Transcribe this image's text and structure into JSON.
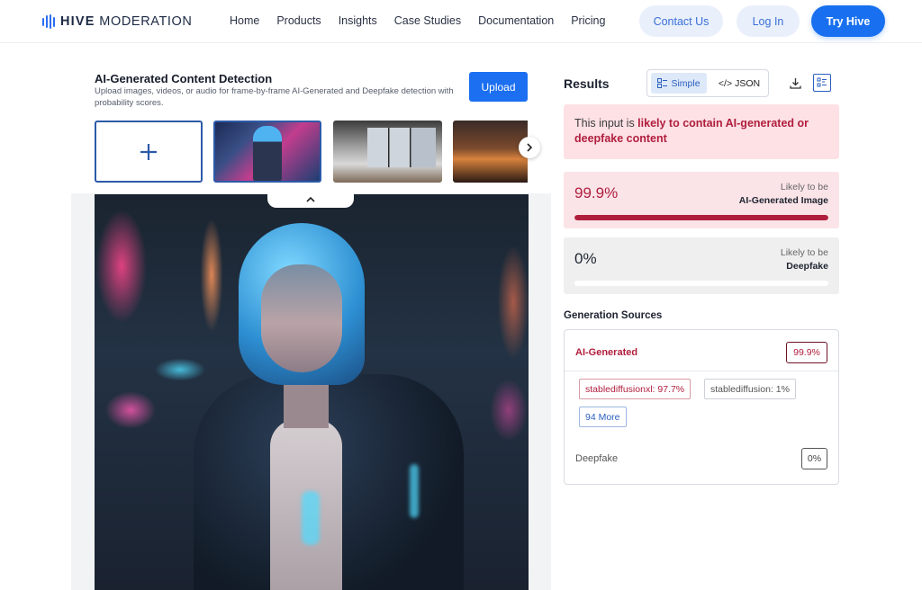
{
  "nav": {
    "brand_bold": "HIVE",
    "brand_rest": "MODERATION",
    "links": [
      "Home",
      "Products",
      "Insights",
      "Case Studies",
      "Documentation",
      "Pricing"
    ],
    "contact": "Contact Us",
    "login": "Log In",
    "try": "Try Hive"
  },
  "detection": {
    "title": "AI-Generated Content Detection",
    "description": "Upload images, videos, or audio for frame-by-frame AI-Generated and Deepfake detection with probability scores.",
    "upload_label": "Upload",
    "add_symbol": "+"
  },
  "results": {
    "title": "Results",
    "simple_label": "Simple",
    "json_label": "JSON",
    "json_prefix": "</>",
    "verdict_prefix": "This input is ",
    "verdict_highlight": "likely to contain AI-generated or deepfake content",
    "ai_generated": {
      "score": "99.9%",
      "likely_to_be": "Likely to be",
      "label": "AI-Generated Image",
      "fill_fraction": 0.999
    },
    "deepfake": {
      "score": "0%",
      "likely_to_be": "Likely to be",
      "label": "Deepfake",
      "fill_fraction": 0.0
    }
  },
  "generation_sources": {
    "title": "Generation Sources",
    "ai_label": "AI-Generated",
    "ai_value": "99.9%",
    "sources": [
      "stablediffusionxl: 97.7%",
      "stablediffusion: 1%"
    ],
    "more_label": "94 More",
    "deepfake_label": "Deepfake",
    "deepfake_value": "0%"
  },
  "colors": {
    "accent_blue": "#1b6ff0",
    "ai_red": "#b01e3d",
    "warn_bg": "#fde1e5"
  }
}
